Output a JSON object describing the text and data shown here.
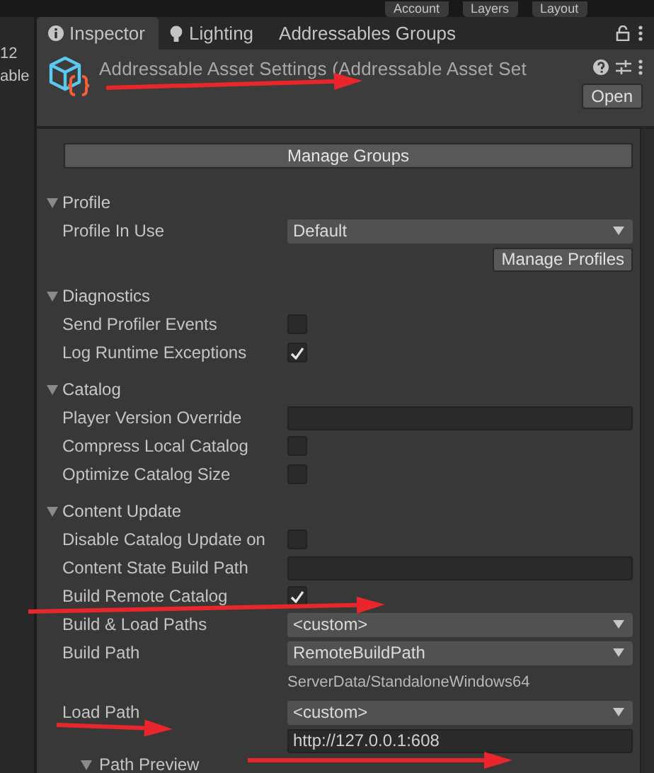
{
  "top_bar": {
    "buttons": [
      "Account",
      "Layers",
      "Layout"
    ]
  },
  "side_panel": {
    "texts": [
      "12",
      "able"
    ]
  },
  "tabs": [
    {
      "label": "Inspector",
      "selected": true,
      "kind": "info"
    },
    {
      "label": "Lighting",
      "selected": false,
      "kind": "light"
    },
    {
      "label": "Addressables Groups",
      "selected": false
    }
  ],
  "header": {
    "title": "Addressable Asset Settings (Addressable Asset Set",
    "open_button": "Open"
  },
  "manage_groups_button": "Manage Groups",
  "sections": [
    {
      "title": "Profile",
      "expanded": true,
      "rows": [
        {
          "kind": "dropdown",
          "label": "Profile In Use",
          "value": "Default"
        },
        {
          "kind": "button",
          "label": "Manage Profiles"
        }
      ]
    },
    {
      "title": "Diagnostics",
      "expanded": true,
      "rows": [
        {
          "kind": "checkbox",
          "label": "Send Profiler Events",
          "checked": false
        },
        {
          "kind": "checkbox",
          "label": "Log Runtime Exceptions",
          "checked": true
        }
      ]
    },
    {
      "title": "Catalog",
      "expanded": true,
      "rows": [
        {
          "kind": "text",
          "label": "Player Version Override"
        },
        {
          "kind": "checkbox",
          "label": "Compress Local Catalog",
          "checked": false
        },
        {
          "kind": "checkbox",
          "label": "Optimize Catalog Size",
          "checked": false
        }
      ]
    },
    {
      "title": "Content Update",
      "expanded": true,
      "rows": [
        {
          "kind": "checkbox",
          "label": "Disable Catalog Update on",
          "checked": false
        },
        {
          "kind": "text",
          "label": "Content State Build Path"
        },
        {
          "kind": "checkbox",
          "label": "Build Remote Catalog",
          "checked": true
        },
        {
          "kind": "dropdown",
          "label": "Build & Load Paths",
          "value": "<custom>"
        },
        {
          "kind": "dropdown",
          "label": "Build Path",
          "value": "RemoteBuildPath"
        },
        {
          "kind": "note",
          "value": "ServerData/StandaloneWindows64"
        },
        {
          "kind": "dropdown",
          "label": "Load Path",
          "value": "<custom>"
        },
        {
          "kind": "text",
          "value": "http://127.0.0.1:608"
        },
        {
          "kind": "foldout",
          "label": "Path Preview",
          "expanded": true
        }
      ]
    }
  ]
}
